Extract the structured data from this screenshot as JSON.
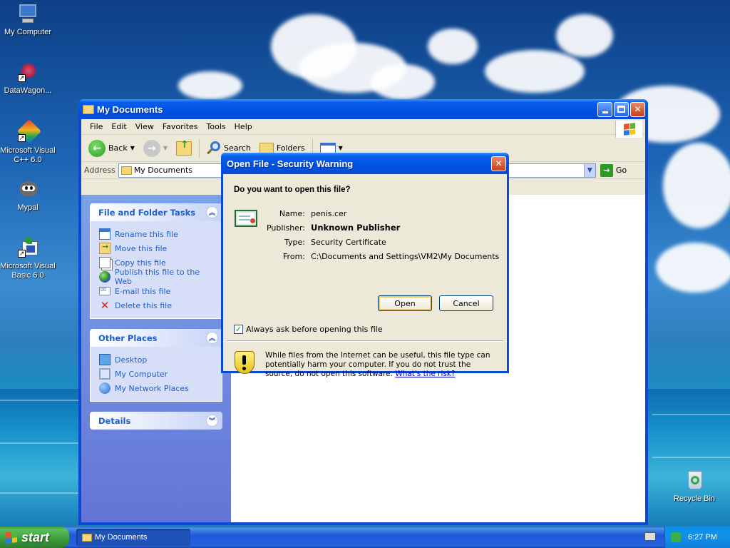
{
  "desktop": {
    "icons": [
      {
        "label": "My Computer"
      },
      {
        "label": "DataWagon..."
      },
      {
        "label": "Microsoft Visual C++ 6.0"
      },
      {
        "label": "Mypal"
      },
      {
        "label": "Microsoft Visual Basic 6.0"
      },
      {
        "label": "Recycle Bin"
      }
    ]
  },
  "explorer": {
    "title": "My Documents",
    "menu": [
      "File",
      "Edit",
      "View",
      "Favorites",
      "Tools",
      "Help"
    ],
    "toolbar": {
      "back": "Back",
      "search": "Search",
      "folders": "Folders"
    },
    "address": {
      "label": "Address",
      "value": "My Documents",
      "go": "Go"
    },
    "file_tasks": {
      "title": "File and Folder Tasks",
      "items": [
        "Rename this file",
        "Move this file",
        "Copy this file",
        "Publish this file to the Web",
        "E-mail this file",
        "Delete this file"
      ]
    },
    "other_places": {
      "title": "Other Places",
      "items": [
        "Desktop",
        "My Computer",
        "My Network Places"
      ]
    },
    "details": {
      "title": "Details"
    }
  },
  "dialog": {
    "title": "Open File - Security Warning",
    "question": "Do you want to open this file?",
    "fields": [
      {
        "key": "Name:",
        "value": "penis.cer"
      },
      {
        "key": "Publisher:",
        "value": "Unknown Publisher"
      },
      {
        "key": "Type:",
        "value": "Security Certificate"
      },
      {
        "key": "From:",
        "value": "C:\\Documents and Settings\\VM2\\My Documents"
      }
    ],
    "open_label": "Open",
    "cancel_label": "Cancel",
    "checkbox_label": "Always ask before opening this file",
    "checkbox_checked": true,
    "warning_text": "While files from the Internet can be useful, this file type can potentially harm your computer. If you do not trust the source, do not open this software.",
    "warning_link": "What's the risk?"
  },
  "taskbar": {
    "start_label": "start",
    "task_label": "My Documents",
    "clock": "6:27 PM"
  },
  "colors": {
    "xp_blue": "#0a49d6",
    "task_link": "#215dc6",
    "start_green": "#3a9b3a"
  }
}
